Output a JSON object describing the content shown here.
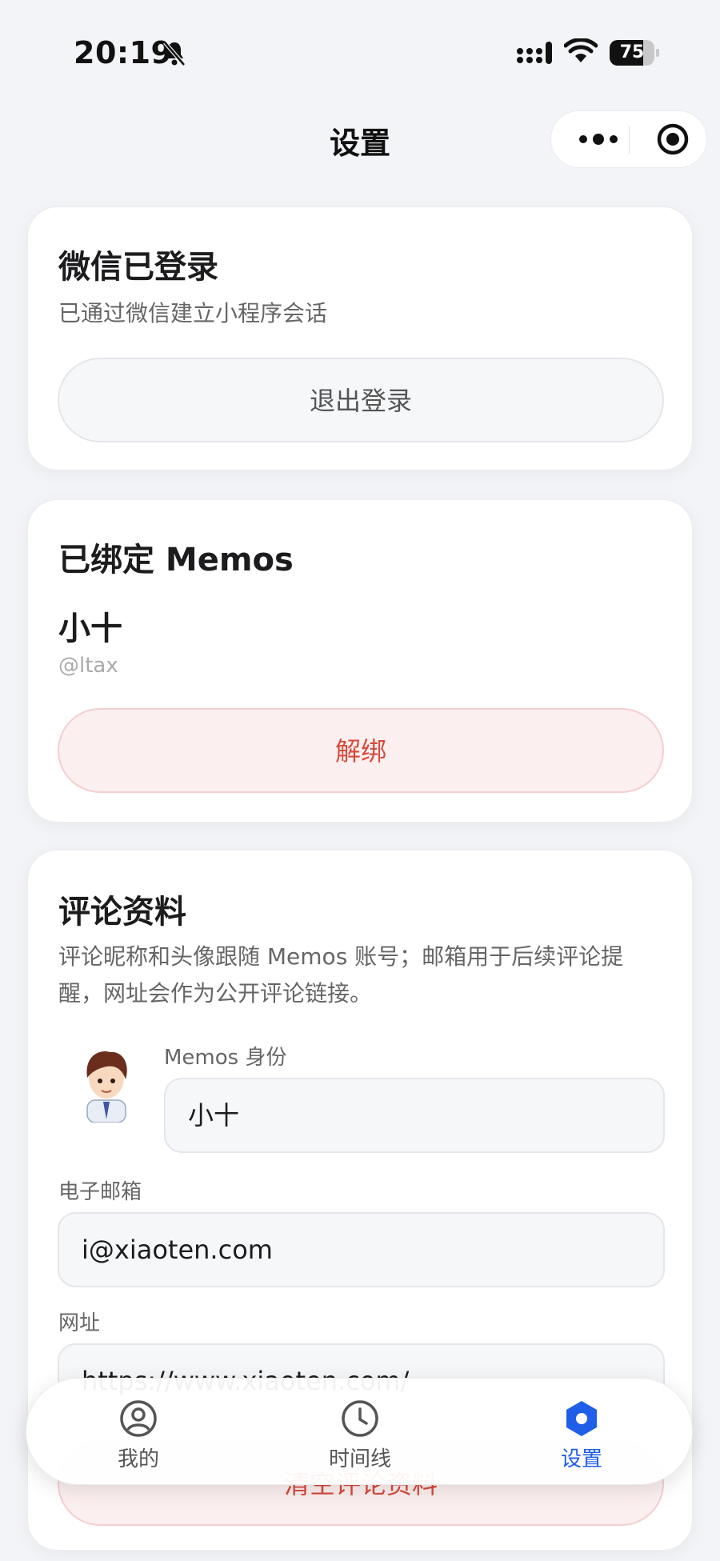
{
  "status_bar": {
    "time": "20:19",
    "battery": "75",
    "battery_level": 0.75
  },
  "nav": {
    "title": "设置"
  },
  "wechat_card": {
    "title": "微信已登录",
    "desc": "已通过微信建立小程序会话",
    "logout_label": "退出登录"
  },
  "memos_card": {
    "title": "已绑定 Memos",
    "name": "小十",
    "handle": "@ltax",
    "unbind_label": "解绑"
  },
  "comment_card": {
    "title": "评论资料",
    "desc_line1": "评论昵称和头像跟随 Memos 账号；邮箱用于后续评论提",
    "desc_line2": "醒，网址会作为公开评论链接。",
    "identity_label": "Memos 身份",
    "identity_value": "小十",
    "email_label": "电子邮箱",
    "email_value": "i@xiaoten.com",
    "url_label": "网址",
    "url_value": "https://www.xiaoten.com/",
    "clear_label": "清空评论资料"
  },
  "tabbar": {
    "tabs": [
      {
        "label": "我的",
        "icon": "user-icon"
      },
      {
        "label": "时间线",
        "icon": "clock-icon"
      },
      {
        "label": "设置",
        "icon": "settings-hexagon-icon"
      }
    ],
    "active_color": "#1e5ee8"
  }
}
